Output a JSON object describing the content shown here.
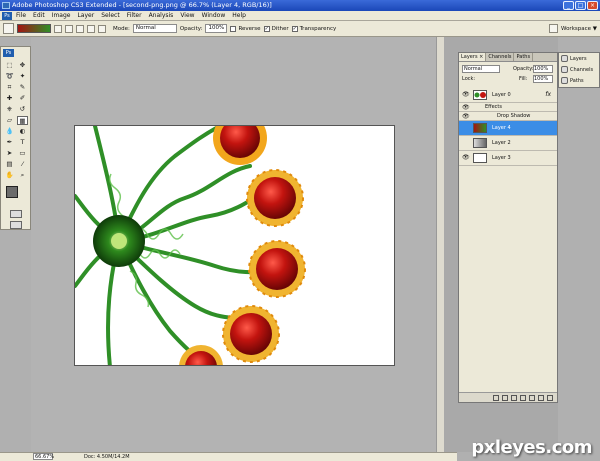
{
  "window": {
    "title": "Adobe Photoshop CS3 Extended - [second-png.png @ 66.7% (Layer 4, RGB/16)]",
    "min": "_",
    "max": "□",
    "close": "×"
  },
  "menu": [
    "File",
    "Edit",
    "Image",
    "Layer",
    "Select",
    "Filter",
    "Analysis",
    "View",
    "Window",
    "Help"
  ],
  "options": {
    "mode_label": "Mode:",
    "mode_value": "Normal",
    "opacity_label": "Opacity:",
    "opacity_value": "100%",
    "reverse": "Reverse",
    "dither": "Dither",
    "transparency": "Transparency",
    "reverse_checked": false,
    "dither_checked": true,
    "transparency_checked": true,
    "workspace": "Workspace ▼",
    "gradient_colors": [
      "#a31412",
      "#2f8f27"
    ]
  },
  "status": {
    "zoom": "66.67%",
    "doc": "Doc: 4.50M/14.2M"
  },
  "layers_panel": {
    "tabs": [
      "Layers ×",
      "Channels",
      "Paths"
    ],
    "blend": "Normal",
    "opacity_label": "Opacity:",
    "opacity_value": "100%",
    "lock_label": "Lock:",
    "fill_label": "Fill:",
    "fill_value": "100%",
    "layers": [
      {
        "name": "Layer 0",
        "fx": "fx"
      },
      {
        "name": "Effects"
      },
      {
        "name": "Drop Shadow"
      },
      {
        "name": "Layer 4",
        "selected": true
      },
      {
        "name": "Layer 2"
      },
      {
        "name": "Layer 3"
      }
    ]
  },
  "side_panel": {
    "items": [
      "Layers",
      "Channels",
      "Paths"
    ]
  },
  "toolbox_tag": "Ps",
  "watermark": "pxleyes.com"
}
